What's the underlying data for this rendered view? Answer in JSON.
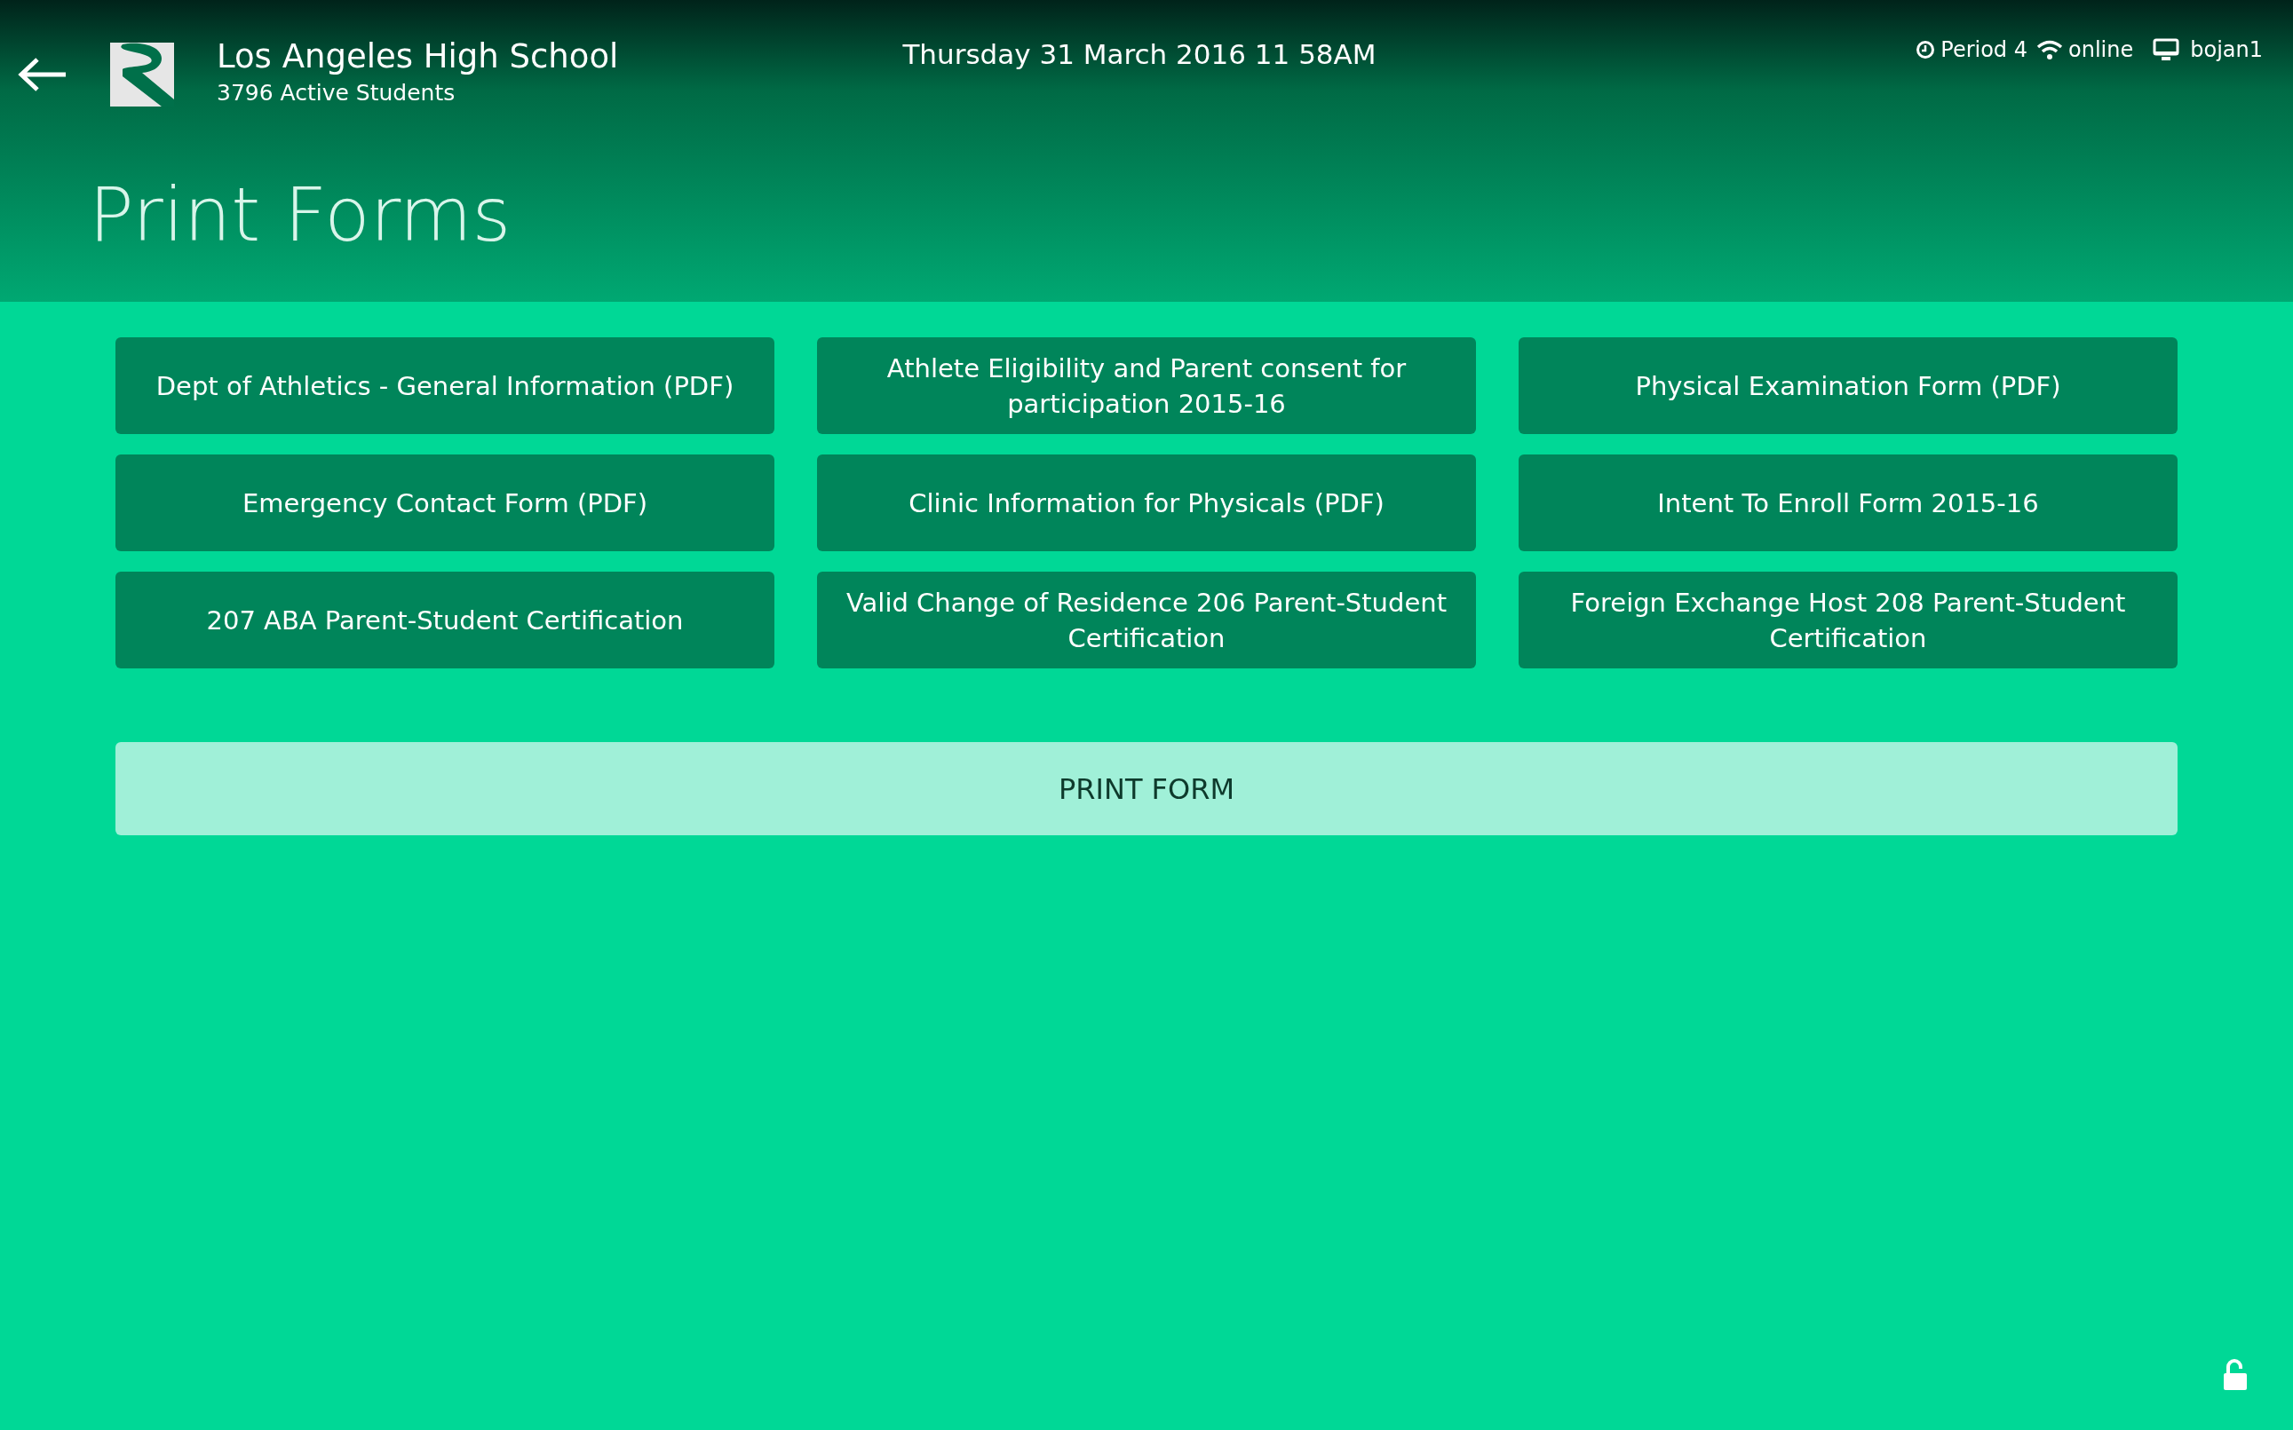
{
  "header": {
    "school_name": "Los Angeles High School",
    "student_count": "3796 Active Students",
    "datetime": "Thursday 31 March 2016 11 58AM",
    "period": "Period 4",
    "connection": "online",
    "user": "bojan1"
  },
  "page_title": "Print Forms",
  "forms": [
    {
      "label": "Dept of Athletics - General Information (PDF)"
    },
    {
      "label": "Athlete Eligibility and Parent consent for participation 2015-16"
    },
    {
      "label": "Physical Examination Form (PDF)"
    },
    {
      "label": "Emergency Contact Form (PDF)"
    },
    {
      "label": "Clinic Information for Physicals (PDF)"
    },
    {
      "label": "Intent To Enroll Form 2015-16"
    },
    {
      "label": "207 ABA Parent-Student Certification"
    },
    {
      "label": "Valid Change of Residence 206 Parent-Student Certification"
    },
    {
      "label": "Foreign Exchange Host 208 Parent-Student Certification"
    }
  ],
  "print_button": "PRINT FORM"
}
